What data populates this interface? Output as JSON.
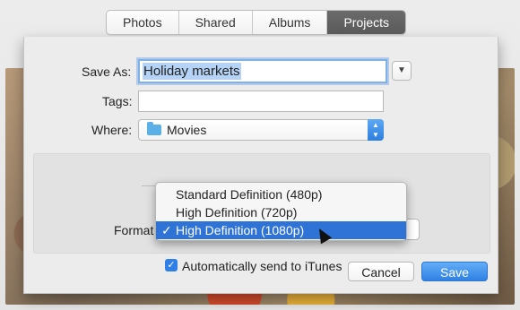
{
  "tabs": [
    "Photos",
    "Shared",
    "Albums",
    "Projects"
  ],
  "active_tab": "Projects",
  "form": {
    "save_as_label": "Save As:",
    "save_as_value": "Holiday markets",
    "tags_label": "Tags:",
    "tags_value": "",
    "where_label": "Where:",
    "where_value": "Movies",
    "format_label": "Format"
  },
  "format_menu": {
    "options": [
      "Standard Definition (480p)",
      "High Definition (720p)",
      "High Definition (1080p)"
    ],
    "selected": "High Definition (1080p)",
    "check_glyph": "✓"
  },
  "auto_send": {
    "label": "Automatically send to iTunes",
    "checked": true
  },
  "buttons": {
    "cancel": "Cancel",
    "save": "Save"
  },
  "colors": {
    "accent": "#2f7fe6",
    "selection": "#b4d3f6"
  },
  "icons": {
    "where": "folder-icon",
    "expand": "chevron-down-icon"
  }
}
